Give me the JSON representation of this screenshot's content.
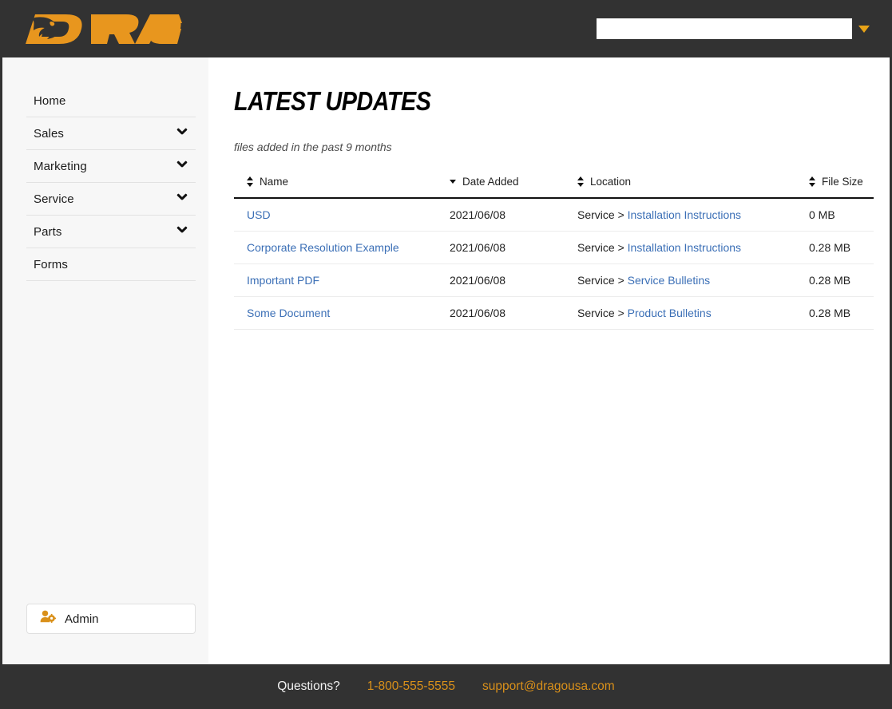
{
  "header": {
    "logo_text": "DRAGO",
    "logo_color": "#e8961e",
    "background": "#323232",
    "search": {
      "value": "",
      "placeholder": ""
    },
    "dropdown_icon": "caret-down-icon"
  },
  "sidebar": {
    "background": "#f7f7f7",
    "items": [
      {
        "label": "Home",
        "has_chevron": false
      },
      {
        "label": "Sales",
        "has_chevron": true
      },
      {
        "label": "Marketing",
        "has_chevron": true
      },
      {
        "label": "Service",
        "has_chevron": true
      },
      {
        "label": "Parts",
        "has_chevron": true
      },
      {
        "label": "Forms",
        "has_chevron": false
      }
    ],
    "admin": {
      "label": "Admin",
      "icon": "user-gear-icon",
      "icon_color": "#d9901a"
    }
  },
  "main": {
    "title": "LATEST UPDATES",
    "subtitle": "files added in the past 9 months",
    "table": {
      "columns": [
        {
          "key": "name",
          "label": "Name",
          "sort": "both"
        },
        {
          "key": "date",
          "label": "Date Added",
          "sort": "desc"
        },
        {
          "key": "location",
          "label": "Location",
          "sort": "both"
        },
        {
          "key": "size",
          "label": "File Size",
          "sort": "both"
        }
      ],
      "rows": [
        {
          "name": "USD",
          "date": "2021/06/08",
          "location_root": "Service > ",
          "location_link": "Installation Instructions",
          "size": "0 MB"
        },
        {
          "name": "Corporate Resolution Example",
          "date": "2021/06/08",
          "location_root": "Service > ",
          "location_link": "Installation Instructions",
          "size": "0.28 MB"
        },
        {
          "name": "Important PDF",
          "date": "2021/06/08",
          "location_root": "Service > ",
          "location_link": "Service Bulletins",
          "size": "0.28 MB"
        },
        {
          "name": "Some Document",
          "date": "2021/06/08",
          "location_root": "Service > ",
          "location_link": "Product Bulletins",
          "size": "0.28 MB"
        }
      ]
    }
  },
  "footer": {
    "background": "#323232",
    "question_label": "Questions?",
    "phone": "1-800-555-5555",
    "email": "support@dragousa.com",
    "link_color": "#d9901a"
  }
}
